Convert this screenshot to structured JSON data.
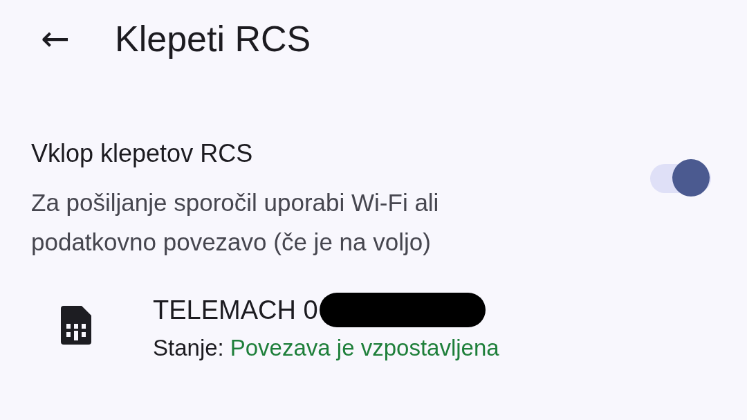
{
  "app_bar": {
    "back_icon": "←",
    "title": "Klepeti RCS"
  },
  "setting": {
    "title": "Vklop klepetov RCS",
    "description": "Za pošiljanje sporočil uporabi Wi-Fi ali podatkovno povezavo (če je na voljo)",
    "on": true
  },
  "sim": {
    "name": "TELEMACH 0",
    "redacted": true,
    "status_label": "Stanje:",
    "status": {
      "text": "Povezava je vzpostavljena",
      "color": "#1e7f3a"
    }
  }
}
